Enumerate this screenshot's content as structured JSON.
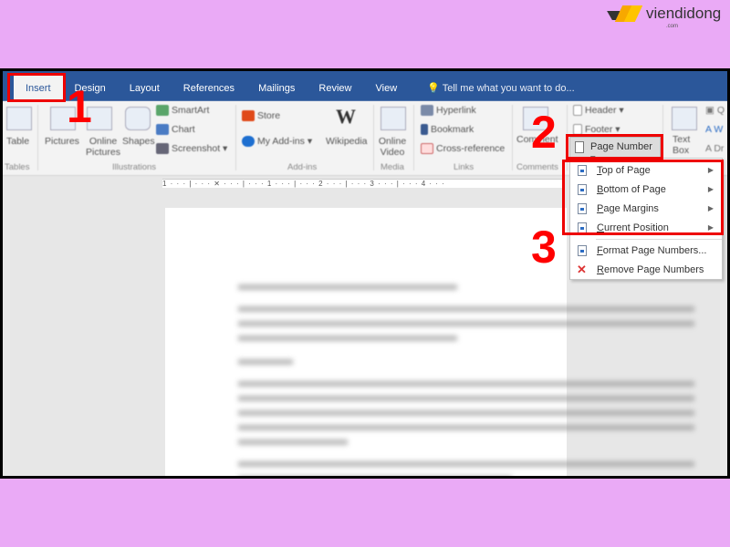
{
  "watermark": {
    "brand": "viendidong",
    "sub": ".com"
  },
  "tabs": [
    "Insert",
    "Design",
    "Layout",
    "References",
    "Mailings",
    "Review",
    "View"
  ],
  "tell_me": "Tell me what you want to do...",
  "ribbon": {
    "table": "Table",
    "tables_group": "Tables",
    "pictures": "Pictures",
    "online_pictures": "Online Pictures",
    "shapes": "Shapes",
    "smartart": "SmartArt",
    "chart": "Chart",
    "screenshot": "Screenshot",
    "illustrations_group": "Illustrations",
    "store": "Store",
    "my_addins": "My Add-ins",
    "wikipedia": "Wikipedia",
    "addins_group": "Add-ins",
    "online_video": "Online Video",
    "media_group": "Media",
    "hyperlink": "Hyperlink",
    "bookmark": "Bookmark",
    "cross_reference": "Cross-reference",
    "links_group": "Links",
    "comment": "Comment",
    "comments_group": "Comments",
    "header": "Header",
    "footer": "Footer",
    "page_number": "Page Number",
    "text_box": "Text Box"
  },
  "ruler": "1 · · · | · · · ✕ · · · | · · · 1 · · · | · · · 2 · · · | · · · 3 · · · | · · · 4 · · ·",
  "page_number_menu": {
    "submenu_items": [
      {
        "prefix": "T",
        "rest": "op of Page"
      },
      {
        "prefix": "B",
        "rest": "ottom of Page"
      },
      {
        "prefix": "P",
        "rest": "age Margins"
      },
      {
        "prefix": "C",
        "rest": "urrent Position"
      }
    ],
    "actions": [
      {
        "prefix": "F",
        "rest": "ormat Page Numbers..."
      },
      {
        "prefix": "R",
        "rest": "emove Page Numbers"
      }
    ]
  },
  "step_labels": [
    "1",
    "2",
    "3"
  ],
  "colors": {
    "background": "#eaaaf6",
    "tab_bar": "#2b579a",
    "highlight": "#ee0000"
  }
}
